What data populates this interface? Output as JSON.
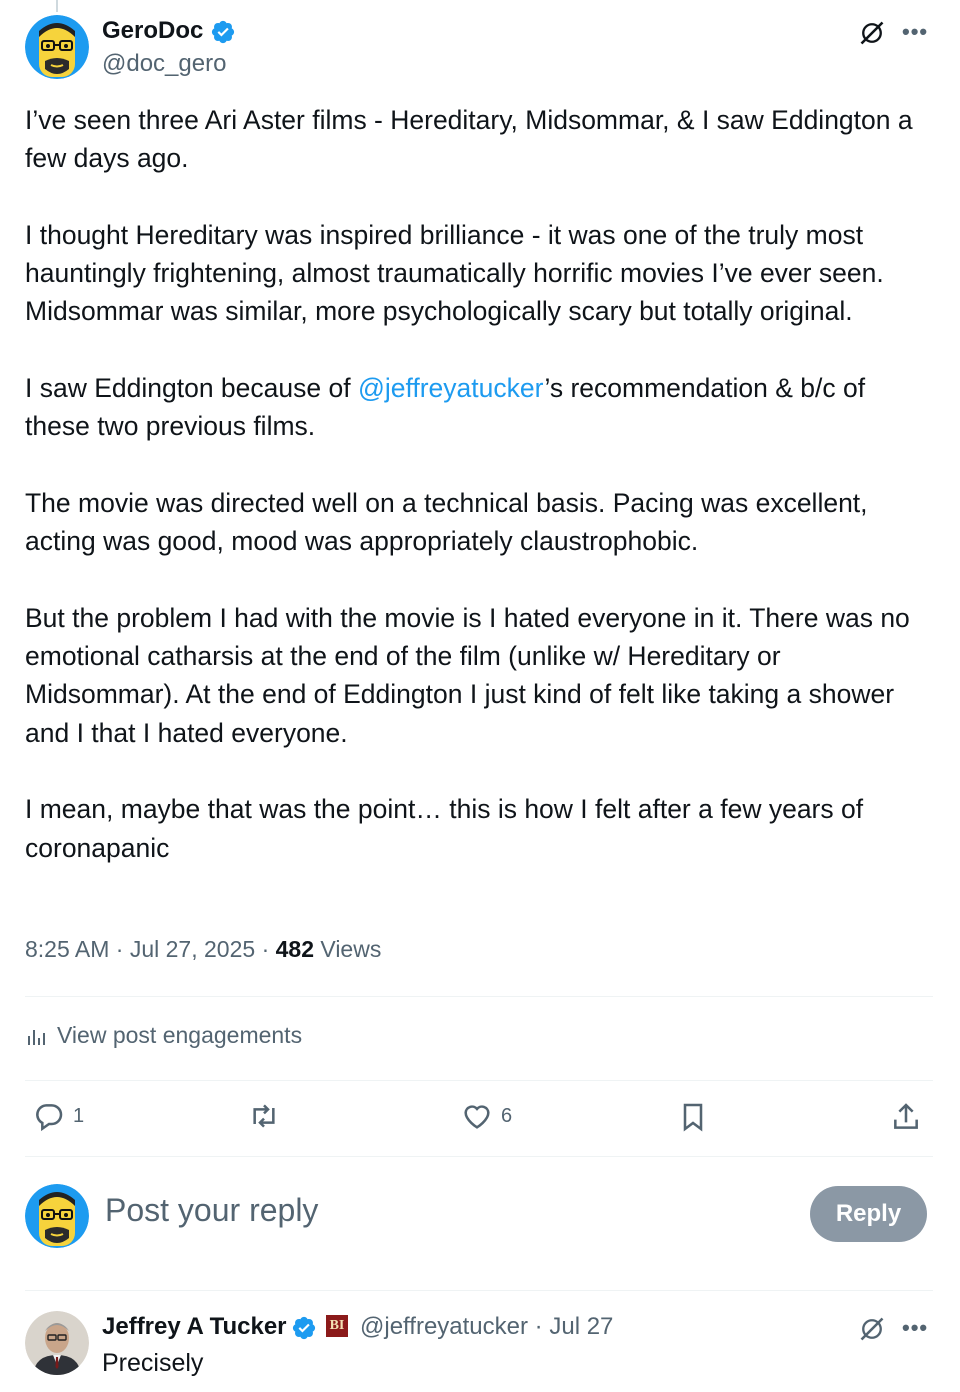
{
  "post": {
    "author_name": "GeroDoc",
    "author_handle": "@doc_gero",
    "paragraphs": [
      [
        "I’ve seen three Ari Aster films - Hereditary, Midsommar, & I saw Eddington a few days ago."
      ],
      [
        "I thought Hereditary was inspired brilliance - it was one of the truly most hauntingly frightening, almost traumatically horrific movies I’ve ever seen. Midsommar was similar, more psychologically scary but totally original."
      ],
      [
        "I saw Eddington because of ",
        "@jeffreyatucker",
        "’s recommendation & b/c  of these two previous films."
      ],
      [
        "The movie was directed well on a technical basis. Pacing was excellent, acting was good, mood was appropriately claustrophobic."
      ],
      [
        "But the problem I had with the movie is I hated everyone in it. There was no emotional catharsis at the end of the film (unlike w/ Hereditary or Midsommar). At the end of Eddington I just kind of felt like taking a shower and I that I hated everyone."
      ],
      [
        "I mean, maybe that was the point… this is how I felt after a few years of coronapanic"
      ]
    ],
    "time": "8:25 AM",
    "date": "Jul 27, 2025",
    "views_count": "482",
    "views_label": "Views",
    "separator": "·",
    "engagements_label": "View post engagements",
    "reply_count": "1",
    "like_count": "6"
  },
  "composer": {
    "placeholder": "Post your reply",
    "button_label": "Reply"
  },
  "reply": {
    "author_name": "Jeffrey A Tucker",
    "badge": "BI",
    "author_handle": "@jeffreyatucker",
    "date": "Jul 27",
    "text": "Precisely"
  },
  "icons": {
    "more": "more-icon",
    "grok": "grok-icon",
    "verified": "verified-badge-icon",
    "analytics": "analytics-icon",
    "reply": "reply-icon",
    "repost": "repost-icon",
    "like": "heart-icon",
    "bookmark": "bookmark-icon",
    "share": "share-icon"
  },
  "colors": {
    "accent": "#1d9bf0",
    "text": "#0f1419",
    "muted": "#536471",
    "reply_button": "#8b98a5",
    "avatar_bg": "#1d9bf0",
    "avatar_face": "#f6d33c"
  }
}
